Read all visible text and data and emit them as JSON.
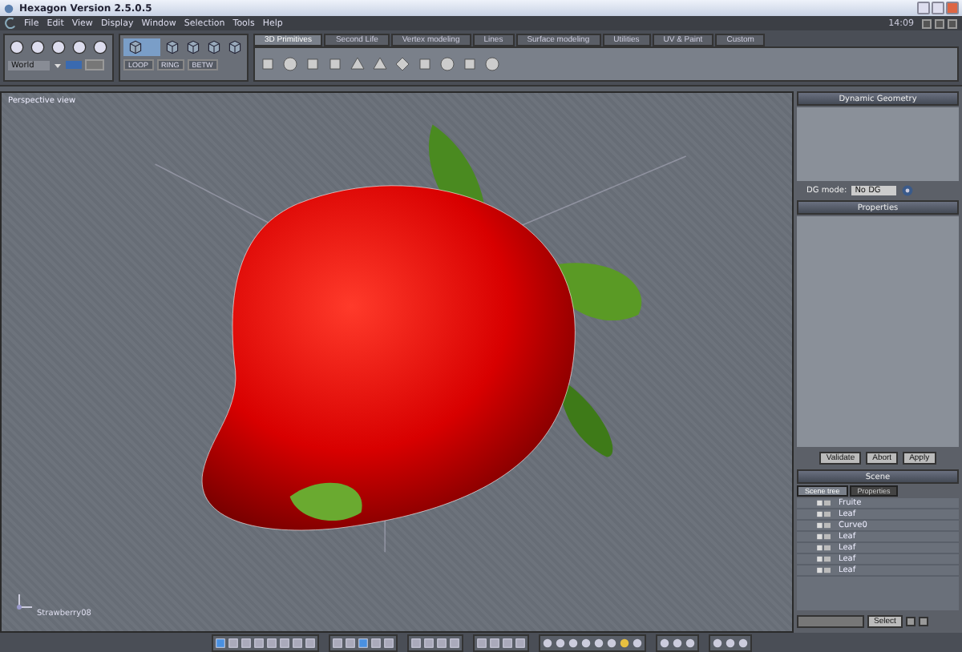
{
  "window": {
    "title": "Hexagon Version 2.5.0.5"
  },
  "menu": [
    "File",
    "Edit",
    "View",
    "Display",
    "Window",
    "Selection",
    "Tools",
    "Help"
  ],
  "clock": "14:09",
  "toolbar": {
    "space_dropdown": "World",
    "toggles": [
      {
        "on": true
      },
      {
        "on": false
      }
    ],
    "edge_buttons": [
      "LOOP",
      "RING",
      "BETW"
    ]
  },
  "tabs": [
    {
      "label": "3D Primitives",
      "selected": true
    },
    {
      "label": "Second Life",
      "selected": false
    },
    {
      "label": "Vertex modeling",
      "selected": false
    },
    {
      "label": "Lines",
      "selected": false
    },
    {
      "label": "Surface modeling",
      "selected": false
    },
    {
      "label": "Utilities",
      "selected": false
    },
    {
      "label": "UV & Paint",
      "selected": false
    },
    {
      "label": "Custom",
      "selected": false
    }
  ],
  "viewport": {
    "label": "Perspective view",
    "object_name": "Strawberry08"
  },
  "dynamic_geometry": {
    "title": "Dynamic Geometry",
    "mode_label": "DG mode:",
    "mode_value": "No DG"
  },
  "properties": {
    "title": "Properties",
    "buttons": [
      "Validate",
      "Abort",
      "Apply"
    ]
  },
  "scene": {
    "title": "Scene",
    "tabs": [
      {
        "label": "Scene tree",
        "selected": true
      },
      {
        "label": "Properties",
        "selected": false
      }
    ],
    "items": [
      "Fruite",
      "Leaf",
      "Curve0",
      "Leaf",
      "Leaf",
      "Leaf",
      "Leaf"
    ],
    "select_button": "Select"
  }
}
